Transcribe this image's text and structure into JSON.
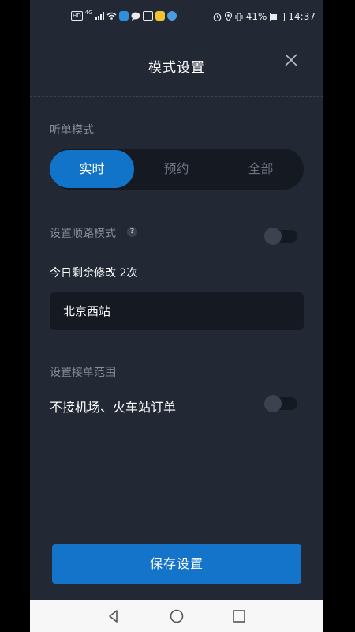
{
  "status_bar": {
    "hd_label": "HD",
    "network": "4G",
    "battery_percent_text": "41%",
    "battery_level": 0.41,
    "time": "14:37"
  },
  "header": {
    "title": "模式设置"
  },
  "listen_mode": {
    "label": "听单模式",
    "options": [
      "实时",
      "预约",
      "全部"
    ],
    "selected": "实时"
  },
  "route_mode": {
    "label": "设置顺路模式",
    "help_symbol": "?",
    "toggle_on": false,
    "remaining_text": "今日剩余修改 2次",
    "destination": "北京西站"
  },
  "order_range": {
    "label": "设置接单范围",
    "option_label": "不接机场、火车站订单",
    "toggle_on": false
  },
  "save_button": {
    "label": "保存设置"
  },
  "colors": {
    "background": "#222834",
    "accent": "#1274c8",
    "field_bg": "#151922",
    "muted_text": "#858c9a"
  }
}
